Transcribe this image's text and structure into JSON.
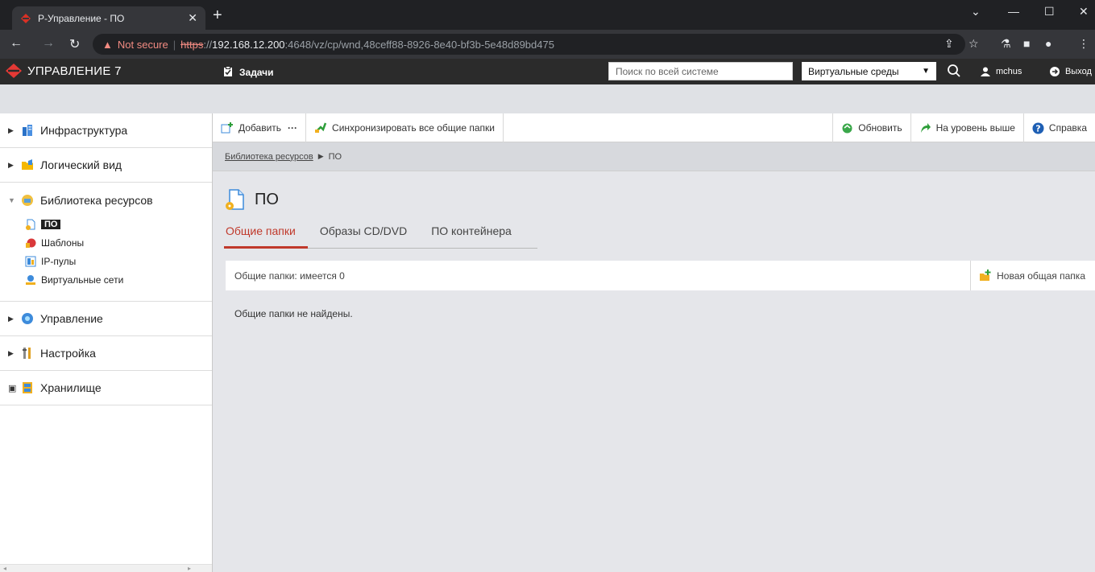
{
  "browser": {
    "tab_title": "Р-Управление - ПО",
    "not_secure": "Not secure",
    "url_protocol": "https",
    "url_rest_sep": "://",
    "url_host": "192.168.12.200",
    "url_path": ":4648/vz/cp/wnd,48ceff88-8926-8e40-bf3b-5e48d89bd475",
    "accent": "#d93025"
  },
  "header": {
    "brand": "УПРАВЛЕНИЕ 7",
    "tasks": "Задачи",
    "search_placeholder": "Поиск по всей системе",
    "env_selected": "Виртуальные среды",
    "user": "mchus",
    "logout": "Выход"
  },
  "sidebar": {
    "items": [
      {
        "label": "Инфраструктура",
        "icon": "infrastructure-icon"
      },
      {
        "label": "Логический вид",
        "icon": "folder-icon"
      }
    ],
    "library": {
      "label": "Библиотека ресурсов",
      "children": [
        {
          "label": "ПО",
          "icon": "software-icon"
        },
        {
          "label": "Шаблоны",
          "icon": "templates-icon"
        },
        {
          "label": "IP-пулы",
          "icon": "ip-pool-icon"
        },
        {
          "label": "Виртуальные сети",
          "icon": "network-icon"
        }
      ]
    },
    "bottom_items": [
      {
        "label": "Управление",
        "icon": "management-icon"
      },
      {
        "label": "Настройка",
        "icon": "settings-icon"
      },
      {
        "label": "Хранилище",
        "icon": "storage-icon"
      }
    ]
  },
  "toolbar": {
    "add": "Добавить",
    "more": "···",
    "sync": "Синхронизировать все общие папки",
    "refresh": "Обновить",
    "up": "На уровень выше",
    "help": "Справка"
  },
  "breadcrumb": {
    "parent": "Библиотека ресурсов",
    "current": "ПО"
  },
  "main": {
    "title": "ПО",
    "tabs": [
      "Общие папки",
      "Образы CD/DVD",
      "ПО контейнера"
    ],
    "list_count": "Общие папки: имеется 0",
    "new_folder": "Новая общая папка",
    "empty": "Общие папки не найдены."
  }
}
